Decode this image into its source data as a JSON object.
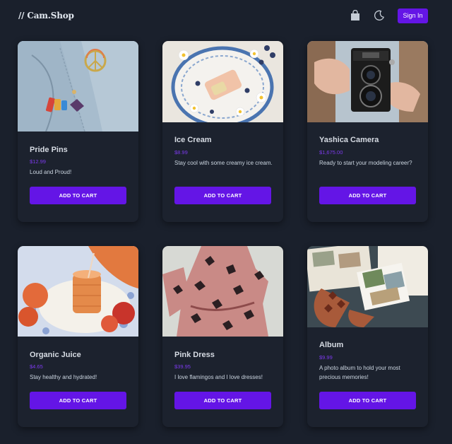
{
  "header": {
    "logo": "// Cam.Shop",
    "signin_label": "Sign In",
    "icons": [
      "shopping-bag-icon",
      "moon-icon"
    ]
  },
  "products": [
    {
      "name": "Pride Pins",
      "price": "$12.99",
      "description": "Loud and Proud!",
      "cta": "ADD TO CART"
    },
    {
      "name": "Ice Cream",
      "price": "$8.99",
      "description": "Stay cool with some creamy ice cream.",
      "cta": "ADD TO CART"
    },
    {
      "name": "Yashica Camera",
      "price": "$1,675.00",
      "description": "Ready to start your modeling career?",
      "cta": "ADD TO CART"
    },
    {
      "name": "Organic Juice",
      "price": "$4.65",
      "description": "Stay healthy and hydrated!",
      "cta": "ADD TO CART"
    },
    {
      "name": "Pink Dress",
      "price": "$39.95",
      "description": "I love flamingos and I love dresses!",
      "cta": "ADD TO CART"
    },
    {
      "name": "Album",
      "price": "$9.99",
      "description": "A photo album to hold your most precious memories!",
      "cta": "ADD TO CART"
    }
  ],
  "colors": {
    "accent": "#6415e6",
    "background": "#1a202c",
    "card": "#1c222e",
    "price": "#7c3aed"
  }
}
